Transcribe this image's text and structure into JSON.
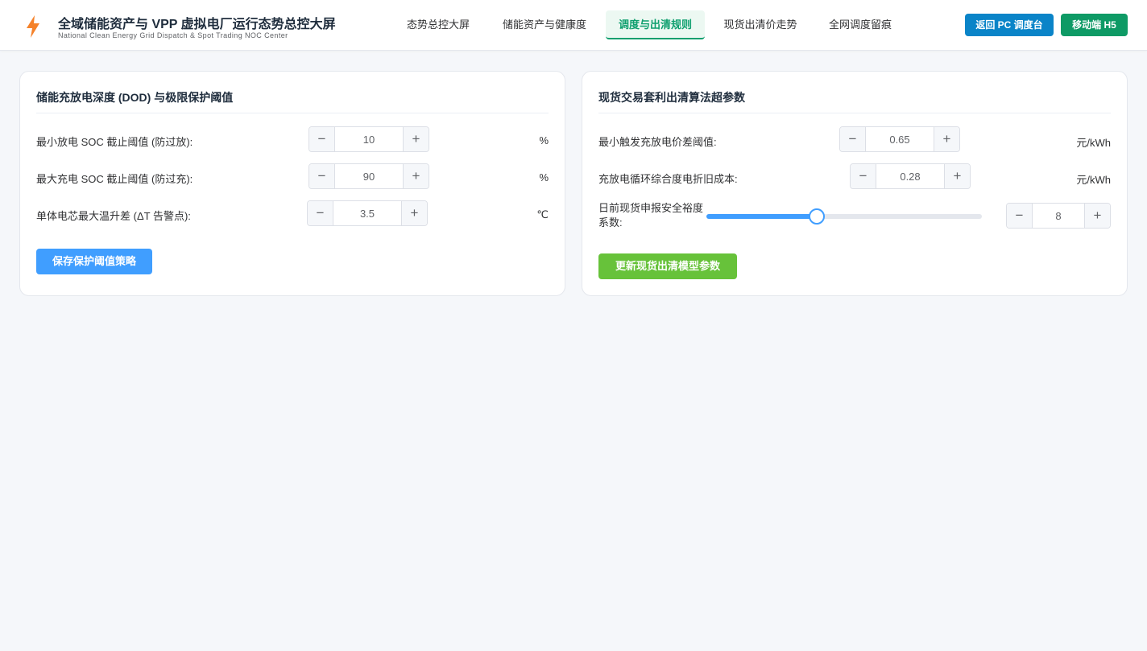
{
  "header": {
    "title": "全域储能资产与 VPP 虚拟电厂运行态势总控大屏",
    "subtitle": "National Clean Energy Grid Dispatch & Spot Trading NOC Center",
    "logo_icon": "lightning-bolt-icon",
    "logo_color": "#f5822a",
    "nav": [
      {
        "label": "态势总控大屏",
        "active": false
      },
      {
        "label": "储能资产与健康度",
        "active": false
      },
      {
        "label": "调度与出清规则",
        "active": true
      },
      {
        "label": "现货出清价走势",
        "active": false
      },
      {
        "label": "全网调度留痕",
        "active": false
      }
    ],
    "buttons": {
      "pc_label": "返回 PC 调度台",
      "mobile_label": "移动端 H5"
    }
  },
  "dod_card": {
    "title": "储能充放电深度 (DOD) 与极限保护阈值",
    "rows": [
      {
        "label": "最小放电 SOC 截止阈值 (防过放):",
        "value": "10",
        "unit": "%"
      },
      {
        "label": "最大充电 SOC 截止阈值 (防过充):",
        "value": "90",
        "unit": "%"
      },
      {
        "label": "单体电芯最大温升差 (ΔT 告警点):",
        "value": "3.5",
        "unit": "℃"
      }
    ],
    "save_label": "保存保护阈值策略"
  },
  "spot_card": {
    "title": "现货交易套利出清算法超参数",
    "rows": [
      {
        "label": "最小触发充放电价差阈值:",
        "value": "0.65",
        "unit": "元/kWh"
      },
      {
        "label": "充放电循环综合度电折旧成本:",
        "value": "0.28",
        "unit": "元/kWh"
      }
    ],
    "slider": {
      "label": "日前现货申报安全裕度系数:",
      "value": "8",
      "fraction": 0.4
    },
    "update_label": "更新现货出清模型参数"
  },
  "colors": {
    "accent_green": "#0e9f6e",
    "primary_blue": "#409eff",
    "success_green": "#67c23a",
    "header_blue": "#0a84c8"
  }
}
